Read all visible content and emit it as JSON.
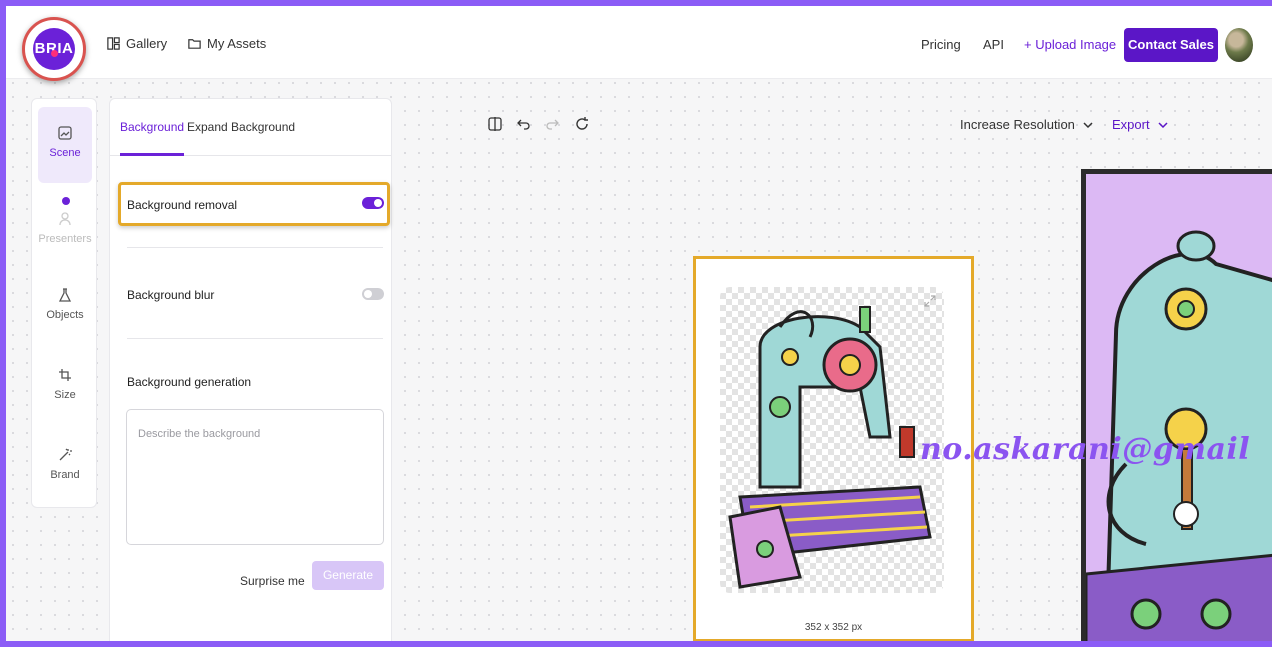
{
  "brand": {
    "logo_text": "BRIA"
  },
  "nav": {
    "gallery": "Gallery",
    "my_assets": "My Assets",
    "pricing": "Pricing",
    "api": "API",
    "upload": "+ Upload Image",
    "contact": "Contact Sales"
  },
  "rail": {
    "items": [
      {
        "label": "Scene",
        "icon": "image-icon"
      },
      {
        "label": "Presenters",
        "icon": "person-icon"
      },
      {
        "label": "Objects",
        "icon": "flask-icon"
      },
      {
        "label": "Size",
        "icon": "crop-icon"
      },
      {
        "label": "Brand",
        "icon": "magic-wand-icon"
      }
    ]
  },
  "panel": {
    "tabs": [
      "Background",
      "Expand Background"
    ],
    "bg_removal": {
      "label": "Background removal",
      "enabled": true
    },
    "bg_blur": {
      "label": "Background blur",
      "enabled": false
    },
    "bg_generation": {
      "label": "Background generation",
      "placeholder": "Describe the background",
      "surprise": "Surprise me",
      "generate": "Generate"
    }
  },
  "toolbar": {
    "icons": [
      "compare-icon",
      "undo-icon",
      "redo-icon",
      "reset-icon"
    ],
    "increase_resolution": "Increase Resolution",
    "export": "Export"
  },
  "canvas": {
    "image_size": "352 x 352 px"
  },
  "watermark": "no.askarani@gmail",
  "colors": {
    "accent": "#6b21d8",
    "highlight": "#e4a92a",
    "frame": "#8b5cf6"
  }
}
